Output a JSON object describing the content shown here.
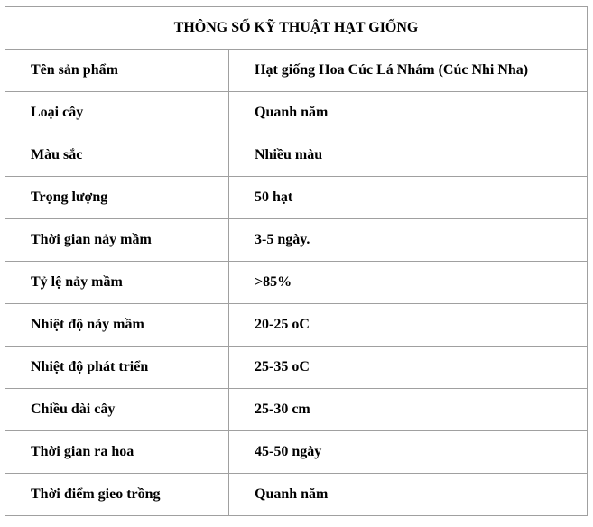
{
  "table": {
    "title": "THÔNG SỐ KỸ THUẬT HẠT GIỐNG",
    "rows": [
      {
        "label": "Tên sản phẩm",
        "value": "Hạt giống Hoa Cúc Lá Nhám (Cúc Nhi Nha)"
      },
      {
        "label": "Loại cây",
        "value": "Quanh năm"
      },
      {
        "label": "Màu sắc",
        "value": "Nhiều màu"
      },
      {
        "label": "Trọng lượng",
        "value": "50 hạt"
      },
      {
        "label": "Thời gian nảy mầm",
        "value": "3-5 ngày."
      },
      {
        "label": "Tỷ lệ nảy mầm",
        "value": ">85%"
      },
      {
        "label": "Nhiệt độ nảy mầm",
        "value": "20-25 oC"
      },
      {
        "label": "Nhiệt độ phát triển",
        "value": "25-35 oC"
      },
      {
        "label": "Chiều dài cây",
        "value": "25-30 cm"
      },
      {
        "label": "Thời gian ra hoa",
        "value": "45-50 ngày"
      },
      {
        "label": "Thời điểm gieo trồng",
        "value": "Quanh năm"
      }
    ]
  }
}
